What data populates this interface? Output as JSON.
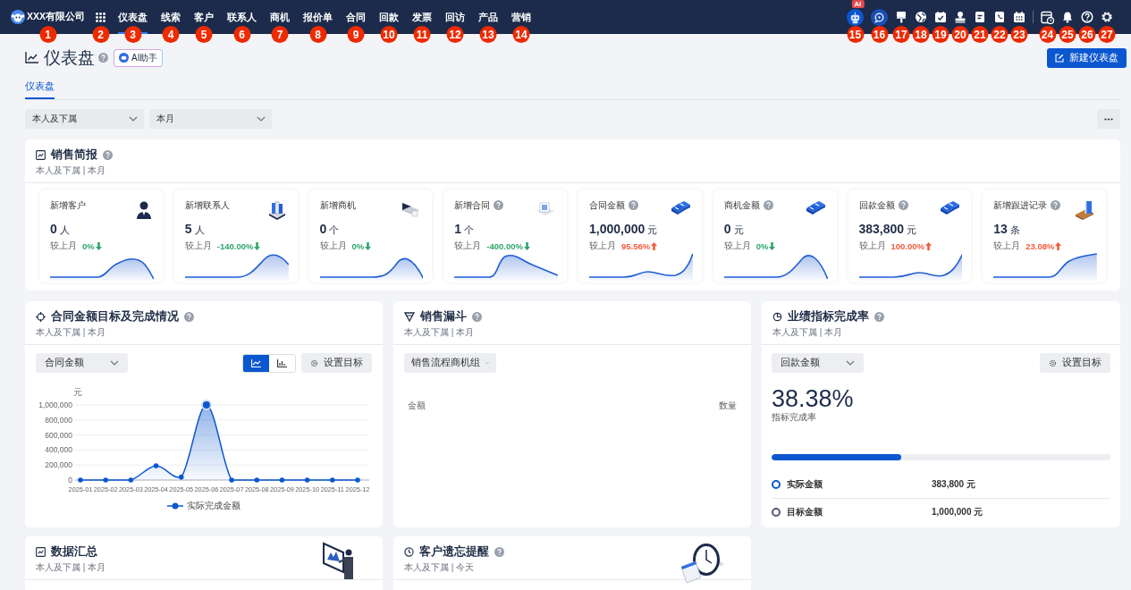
{
  "nav": {
    "company": "XXX有限公司",
    "company_marker": "1",
    "apps_marker": "2",
    "items": [
      {
        "label": "仪表盘",
        "selected": true,
        "marker": "3"
      },
      {
        "label": "线索",
        "selected": false,
        "marker": "4"
      },
      {
        "label": "客户",
        "selected": false,
        "marker": "5"
      },
      {
        "label": "联系人",
        "selected": false,
        "marker": "6"
      },
      {
        "label": "商机",
        "selected": false,
        "marker": "7"
      },
      {
        "label": "报价单",
        "selected": false,
        "marker": "8"
      },
      {
        "label": "合同",
        "selected": false,
        "marker": "9"
      },
      {
        "label": "回款",
        "selected": false,
        "marker": "10"
      },
      {
        "label": "发票",
        "selected": false,
        "marker": "11"
      },
      {
        "label": "回访",
        "selected": false,
        "marker": "12"
      },
      {
        "label": "产品",
        "selected": false,
        "marker": "13"
      },
      {
        "label": "营销",
        "selected": false,
        "marker": "14"
      }
    ],
    "tools": [
      {
        "marker": "15",
        "badge": "AI"
      },
      {
        "marker": "16"
      },
      {
        "marker": "17"
      },
      {
        "marker": "18"
      },
      {
        "marker": "19"
      },
      {
        "marker": "20"
      },
      {
        "marker": "21"
      },
      {
        "marker": "22"
      },
      {
        "marker": "23"
      },
      {
        "marker": "24"
      },
      {
        "marker": "25"
      },
      {
        "marker": "26"
      },
      {
        "marker": "27"
      }
    ]
  },
  "page": {
    "title": "仪表盘",
    "help": true,
    "ai_button": "AI助手",
    "new_button": "新建仪表盘"
  },
  "tabs": [
    {
      "label": "仪表盘",
      "selected": true
    }
  ],
  "filters": [
    "本人及下属",
    "本月"
  ],
  "sales_brief": {
    "title": "销售简报",
    "help": true,
    "scope": "本人及下属 | 本月",
    "cards": [
      {
        "title": "新增客户",
        "help": false,
        "value": "0",
        "unit": "人",
        "compare": "较上月",
        "change": "0%",
        "rising": false
      },
      {
        "title": "新增联系人",
        "help": false,
        "value": "5",
        "unit": "人",
        "compare": "较上月",
        "change": "-140.00%",
        "rising": false
      },
      {
        "title": "新增商机",
        "help": false,
        "value": "0",
        "unit": "个",
        "compare": "较上月",
        "change": "0%",
        "rising": false
      },
      {
        "title": "新增合同",
        "help": true,
        "value": "1",
        "unit": "个",
        "compare": "较上月",
        "change": "-400.00%",
        "rising": false
      },
      {
        "title": "合同金额",
        "help": true,
        "value": "1,000,000",
        "unit": "元",
        "compare": "较上月",
        "change": "95.56%",
        "rising": true
      },
      {
        "title": "商机金额",
        "help": true,
        "value": "0",
        "unit": "元",
        "compare": "较上月",
        "change": "0%",
        "rising": false
      },
      {
        "title": "回款金额",
        "help": true,
        "value": "383,800",
        "unit": "元",
        "compare": "较上月",
        "change": "100.00%",
        "rising": true
      },
      {
        "title": "新增跟进记录",
        "help": true,
        "value": "13",
        "unit": "条",
        "compare": "较上月",
        "change": "23.08%",
        "rising": true
      }
    ]
  },
  "target_panel": {
    "title": "合同金额目标及完成情况",
    "help": true,
    "scope": "本人及下属 | 本月",
    "metric": "合同金额",
    "view_toggle": [
      {
        "selected": true
      },
      {
        "selected": false
      }
    ],
    "set_target": "设置目标",
    "chart_data": {
      "type": "area",
      "ylabel": "元",
      "categories": [
        "2025-01",
        "2025-02",
        "2025-03",
        "2025-04",
        "2025-05",
        "2025-06",
        "2025-07",
        "2025-08",
        "2025-09",
        "2025-10",
        "2025-11",
        "2025-12"
      ],
      "series": [
        {
          "name": "实际完成金额",
          "color": "#0b57d0",
          "values": [
            0,
            0,
            0,
            190000,
            40000,
            1000000,
            0,
            0,
            0,
            0,
            0,
            0
          ]
        }
      ],
      "ylim": [
        0,
        1000000
      ],
      "grid": true,
      "yticks": [
        {
          "value": 0,
          "label": "0"
        },
        {
          "value": 200000,
          "label": "200,000"
        },
        {
          "value": 400000,
          "label": "400,000"
        },
        {
          "value": 600000,
          "label": "600,000"
        },
        {
          "value": 800000,
          "label": "800,000"
        },
        {
          "value": 1000000,
          "label": "1,000,000"
        }
      ]
    }
  },
  "funnel": {
    "title": "销售漏斗",
    "help": true,
    "scope": "本人及下属 | 本月",
    "group": "销售流程商机组",
    "left_label": "金额",
    "right_label": "数量"
  },
  "performance": {
    "title": "业绩指标完成率",
    "help": true,
    "scope": "本人及下属 | 本月",
    "metric": "回款金额",
    "set_target": "设置目标",
    "rate": "38.38%",
    "rate_label": "指标完成率",
    "level": 0.3838,
    "rows": [
      {
        "label": "实际金额",
        "value": "383,800 元",
        "color": "#0b57d0"
      },
      {
        "label": "目标金额",
        "value": "1,000,000 元",
        "color": "#555b72"
      }
    ]
  },
  "summary": {
    "title": "数据汇总",
    "help": false,
    "scope": "本人及下属 | 本月"
  },
  "reminder": {
    "title": "客户遗忘提醒",
    "help": true,
    "scope": "本人及下属 | 今天"
  }
}
